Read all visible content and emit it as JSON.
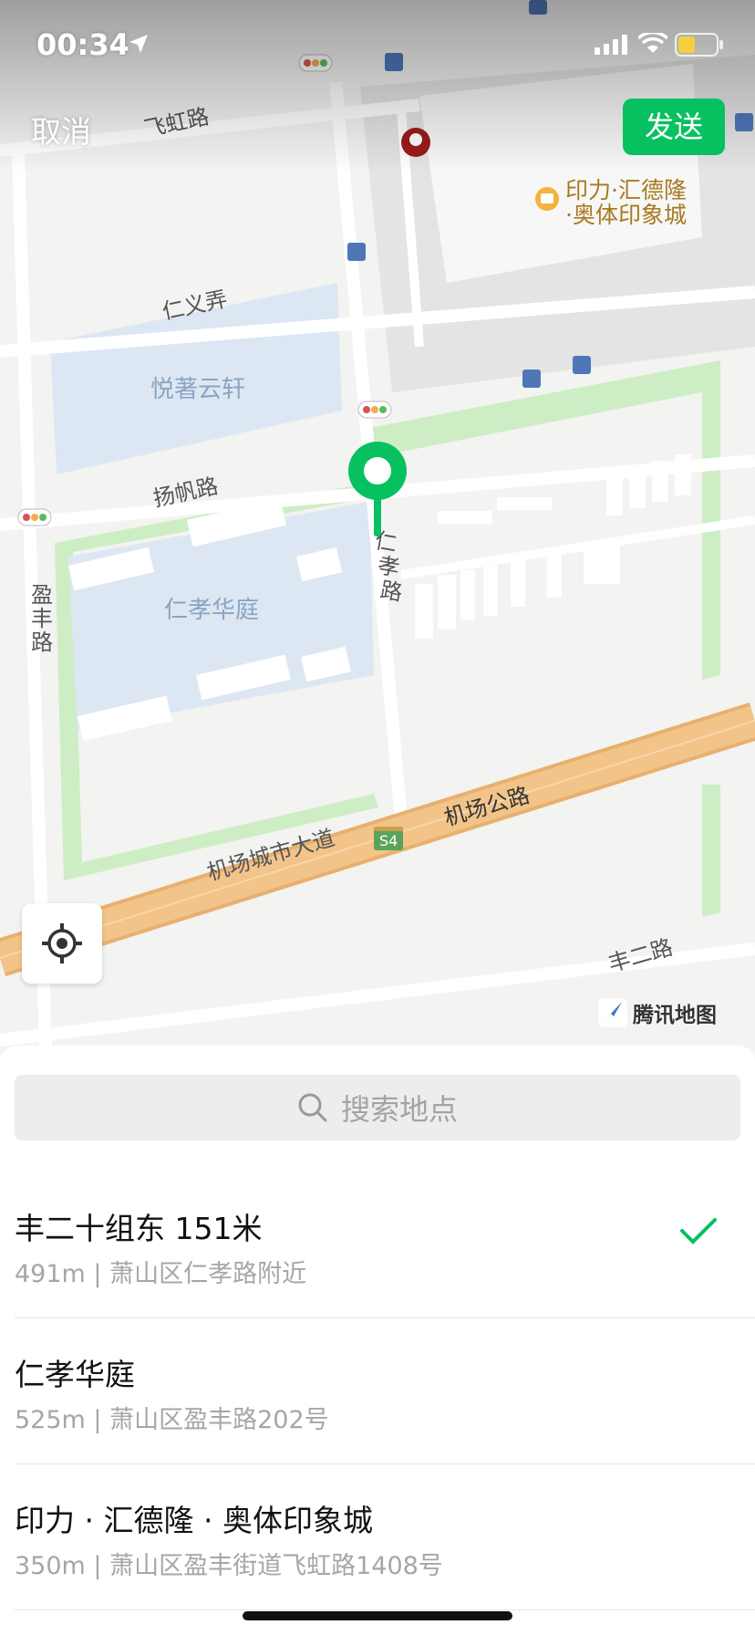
{
  "status_bar": {
    "time": "00:34"
  },
  "header": {
    "cancel_label": "取消",
    "send_label": "发送"
  },
  "map": {
    "labels": {
      "feihong_road": "飞虹路",
      "renyi_lane": "仁义弄",
      "yueshu_yunxuan": "悦著云轩",
      "yangfan_road": "扬帆路",
      "renxiao_road": "仁孝路",
      "yingfeng_road": "盈丰路",
      "renxiao_huating": "仁孝华庭",
      "airport_city_ave": "机场城市大道",
      "airport_highway": "机场公路",
      "highway_shield": "S4",
      "feng_second_road": "丰二路",
      "poi_yinli": "印力·汇德隆\n·奥体印象城"
    },
    "poi_line1": "印力·汇德隆",
    "poi_line2": "·奥体印象城",
    "brand": "腾讯地图",
    "icons": [
      "location-arrow-icon",
      "signal-icon",
      "wifi-icon",
      "battery-icon",
      "kfc-icon",
      "mall-icon",
      "bus-stop-icon",
      "traffic-light-icon",
      "map-pin-icon",
      "locate-icon",
      "tencent-map-logo-icon",
      "search-icon",
      "checkmark-icon"
    ]
  },
  "colors": {
    "accent": "#07c160",
    "road_major": "#f2c48a",
    "green_belt": "#cdeec4",
    "block": "#dde7f3"
  },
  "search": {
    "placeholder": "搜索地点"
  },
  "results": [
    {
      "name": "丰二十组东 151米",
      "sub": "491m | 萧山区仁孝路附近",
      "selected": true
    },
    {
      "name": "仁孝华庭",
      "sub": "525m | 萧山区盈丰路202号",
      "selected": false
    },
    {
      "name": "印力 · 汇德隆 · 奥体印象城",
      "sub": "350m | 萧山区盈丰街道飞虹路1408号",
      "selected": false
    }
  ]
}
